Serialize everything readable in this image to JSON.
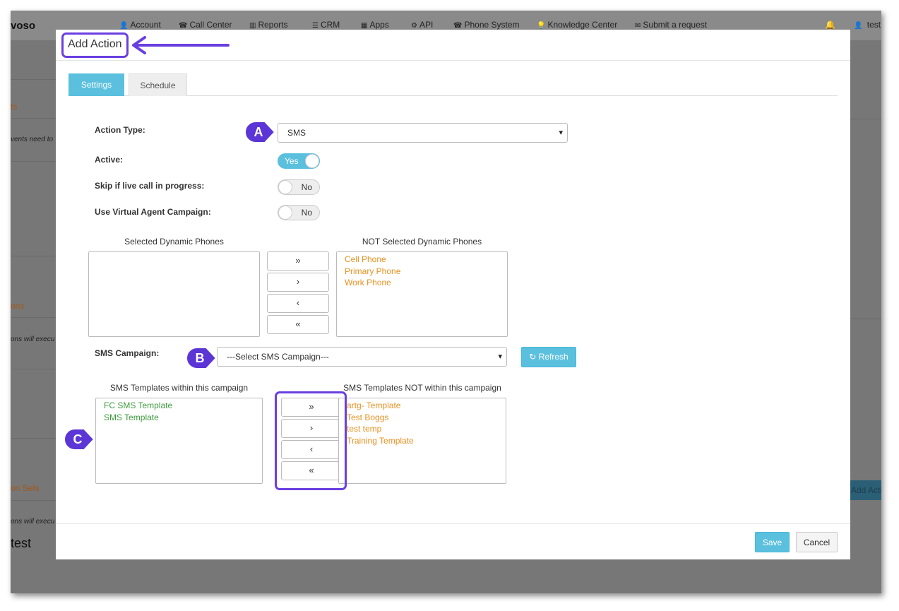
{
  "app": {
    "brand": "voso",
    "nav": [
      {
        "icon": "user-icon",
        "glyph": "👤",
        "label": "Account"
      },
      {
        "icon": "phone-icon",
        "glyph": "☎",
        "label": "Call Center"
      },
      {
        "icon": "bar-chart-icon",
        "glyph": "▥",
        "label": "Reports"
      },
      {
        "icon": "list-icon",
        "glyph": "☰",
        "label": "CRM"
      },
      {
        "icon": "grid-icon",
        "glyph": "▦",
        "label": "Apps"
      },
      {
        "icon": "gear-icon",
        "glyph": "⚙",
        "label": "API"
      },
      {
        "icon": "phone-icon",
        "glyph": "☎",
        "label": "Phone System"
      },
      {
        "icon": "lightbulb-icon",
        "glyph": "💡",
        "label": "Knowledge Center"
      },
      {
        "icon": "ticket-icon",
        "glyph": "✉",
        "label": "Submit a request"
      }
    ],
    "user": "test",
    "background_fragments": {
      "f1": "ts",
      "f2": "vents need to",
      "f3": "ons",
      "f4": "ons will execu",
      "f5": "on Sets",
      "f6": "ons will execu",
      "f7": "test",
      "right_button": "Add Acti"
    }
  },
  "modal": {
    "title": "Add Action",
    "tabs": [
      "Settings",
      "Schedule"
    ],
    "action_type_label": "Action Type:",
    "action_type_value": "SMS",
    "active_label": "Active:",
    "active_value": "Yes",
    "skip_label": "Skip if live call in progress:",
    "skip_value": "No",
    "virtual_agent_label": "Use Virtual Agent Campaign:",
    "virtual_agent_value": "No",
    "phones": {
      "selected_caption": "Selected Dynamic Phones",
      "not_selected_caption": "NOT Selected Dynamic Phones",
      "selected": [],
      "not_selected": [
        "Cell Phone",
        "Primary Phone",
        "Work Phone"
      ]
    },
    "sms_campaign_label": "SMS Campaign:",
    "sms_campaign_value": "---Select SMS Campaign---",
    "refresh_label": "Refresh",
    "templates": {
      "within_caption": "SMS Templates within this campaign",
      "not_within_caption": "SMS Templates NOT within this campaign",
      "within": [
        "FC SMS Template",
        "SMS Template"
      ],
      "not_within": [
        "artg- Template",
        "Test Boggs",
        "test temp",
        "Training Template"
      ]
    },
    "move_buttons": [
      "»",
      "›",
      "‹",
      "«"
    ],
    "save_label": "Save",
    "cancel_label": "Cancel"
  },
  "annotations": {
    "markers": [
      "A",
      "B",
      "C"
    ],
    "accent_color": "#6a3fe0"
  },
  "colors": {
    "info": "#5bc0de",
    "orange_item": "#e69222",
    "green_item": "#3e9b3e"
  }
}
